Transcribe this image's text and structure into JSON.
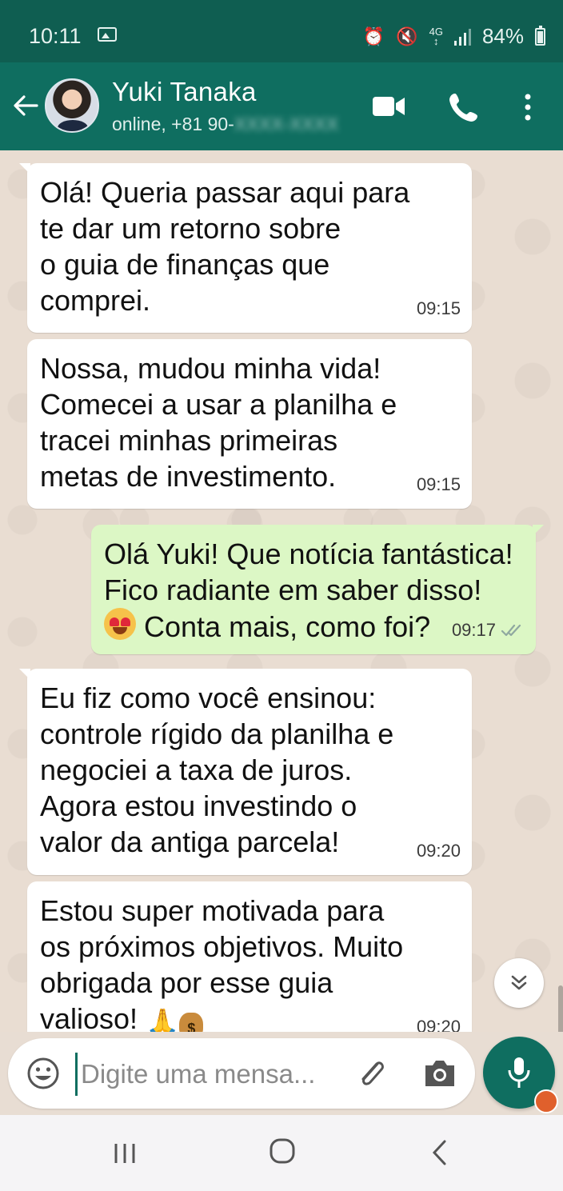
{
  "status_bar": {
    "time": "10:11",
    "network": "4G",
    "battery": "84%",
    "icons": [
      "gallery-icon",
      "alarm-icon",
      "mute-icon",
      "signal-icon",
      "battery-icon"
    ]
  },
  "header": {
    "name": "Yuki Tanaka",
    "status_prefix": "online, +81 90-",
    "status_masked": "XXXX-XXXX",
    "icons": [
      "back-arrow-icon",
      "video-call-icon",
      "voice-call-icon",
      "more-options-icon"
    ]
  },
  "messages": [
    {
      "direction": "in",
      "text": "Olá! Queria passar aqui para\nte dar um retorno sobre\no guia de finanças que\ncomprei.",
      "time": "09:15"
    },
    {
      "direction": "in",
      "text": "Nossa, mudou minha vida!\nComecei a usar a planilha e\ntracei minhas primeiras\nmetas de investimento.",
      "time": "09:15"
    },
    {
      "direction": "out",
      "text_line1": "Olá Yuki! Que notícia fantástica!",
      "text_line2": "Fico radiante em saber disso!",
      "text_line3": "Conta mais, como foi?",
      "emoji": "heart-eyes-emoji",
      "time": "09:17",
      "status": "read"
    },
    {
      "direction": "in",
      "text": "Eu fiz como você ensinou:\ncontrole rígido da planilha e\nnegociei a taxa de juros.\nAgora estou investindo o\nvalor da antiga parcela!",
      "time": "09:20"
    },
    {
      "direction": "in",
      "text": "Estou super motivada para\nos próximos objetivos. Muito\nobrigada por esse guia\nvalioso!",
      "emojis": [
        "praying-hands-emoji",
        "money-bag-emoji"
      ],
      "time": "09:20"
    }
  ],
  "composer": {
    "placeholder": "Digite uma mensa...",
    "icons": [
      "emoji-icon",
      "attach-icon",
      "camera-icon",
      "mic-icon"
    ]
  },
  "colors": {
    "status_bar": "#0f5e51",
    "header": "#0f6e60",
    "outgoing_bubble": "#dcf7c5",
    "incoming_bubble": "#ffffff",
    "chat_bg": "#e9ddd2"
  }
}
